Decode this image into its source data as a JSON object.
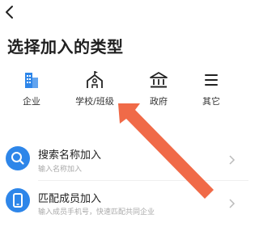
{
  "page": {
    "title": "选择加入的类型"
  },
  "types": [
    {
      "label": "企业",
      "icon": "building-icon"
    },
    {
      "label": "学校/班级",
      "icon": "school-icon"
    },
    {
      "label": "政府",
      "icon": "government-icon"
    },
    {
      "label": "其它",
      "icon": "menu-lines-icon"
    }
  ],
  "rows": [
    {
      "title": "搜索名称加入",
      "subtitle": "输入名称加入",
      "icon": "search-icon"
    },
    {
      "title": "匹配成员加入",
      "subtitle": "输入成员手机号，快速匹配共同企业",
      "icon": "phone-icon"
    }
  ],
  "colors": {
    "accent": "#2e86e9",
    "annotation_arrow": "#f06a48"
  }
}
